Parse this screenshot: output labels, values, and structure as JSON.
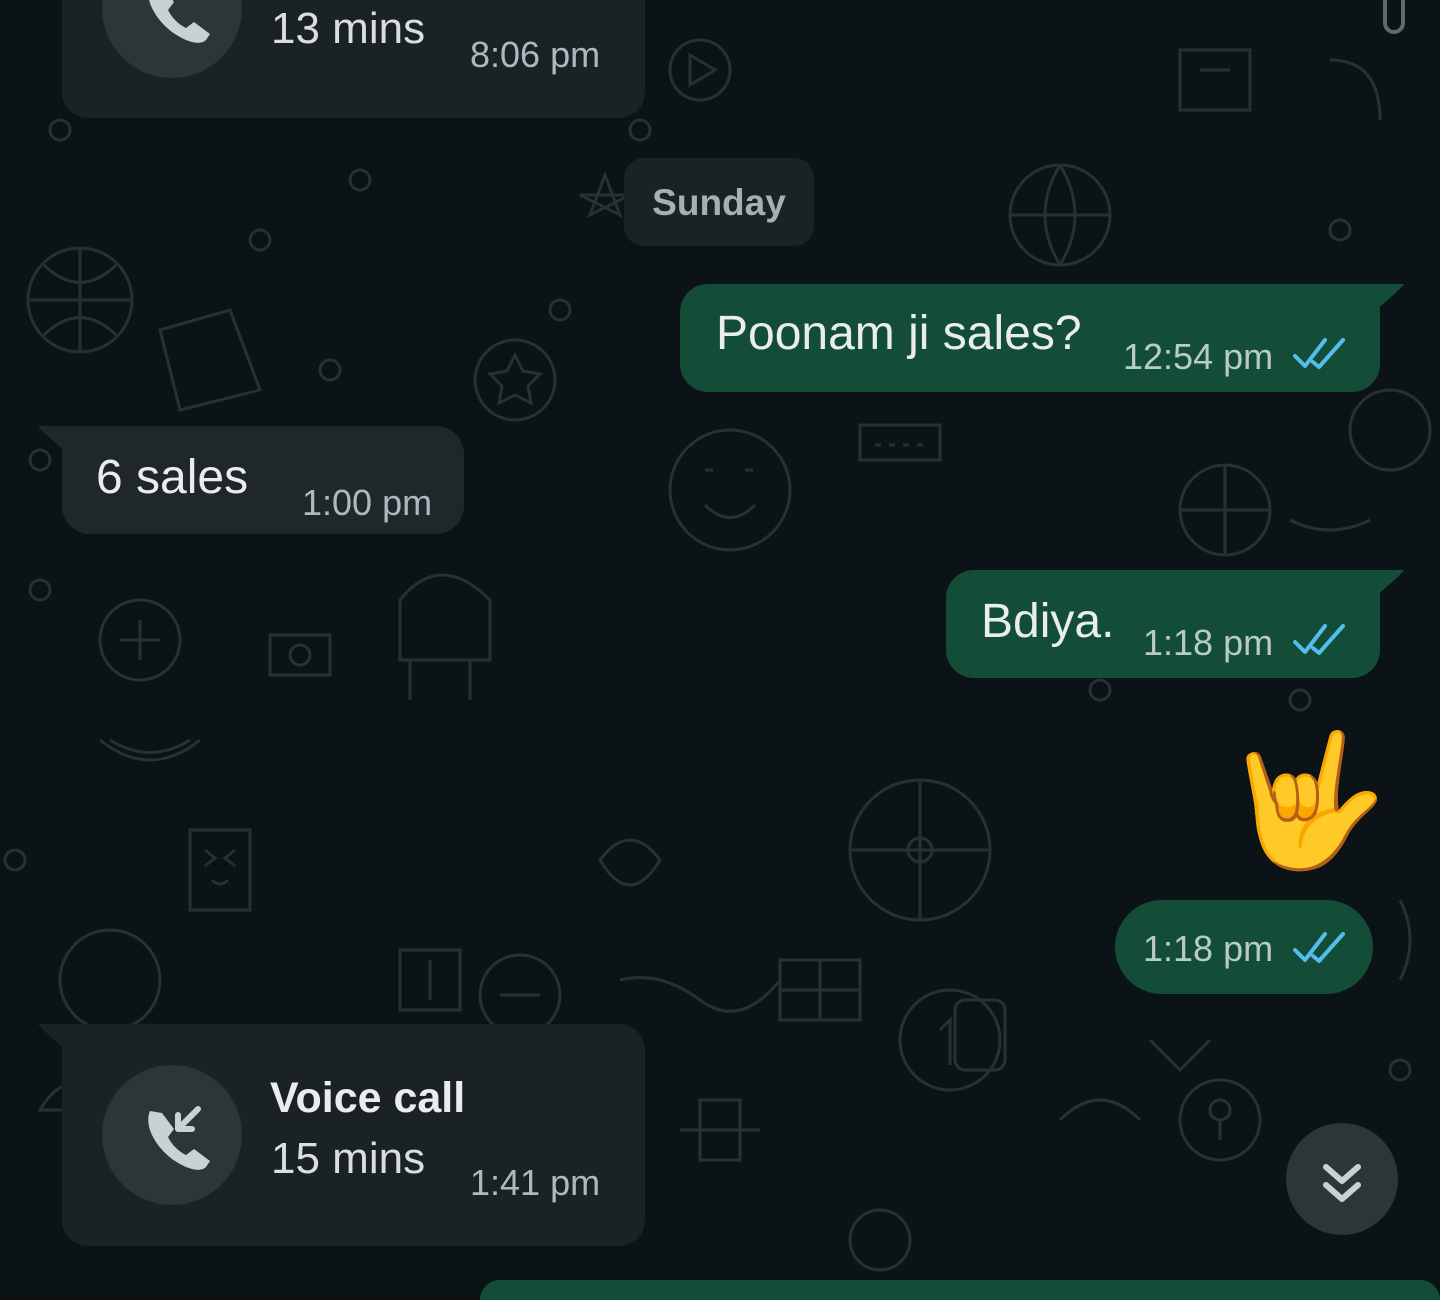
{
  "colors": {
    "background": "#0c1317",
    "incoming_bubble": "#1f272a",
    "outgoing_bubble": "#144d37",
    "read_ticks": "#53bdeb"
  },
  "top_call": {
    "duration": "13 mins",
    "time": "8:06 pm",
    "icon": "phone-call-icon"
  },
  "date_divider": "Sunday",
  "messages": [
    {
      "direction": "outgoing",
      "text": "Poonam ji sales?",
      "time": "12:54 pm",
      "status": "read"
    },
    {
      "direction": "incoming",
      "text": "6 sales",
      "time": "1:00 pm"
    },
    {
      "direction": "outgoing",
      "text": "Bdiya.",
      "time": "1:18 pm",
      "status": "read"
    },
    {
      "direction": "outgoing",
      "text": "🤟",
      "time": "1:18 pm",
      "status": "read"
    }
  ],
  "voice_call": {
    "title": "Voice call",
    "duration": "15 mins",
    "time": "1:41 pm",
    "icon": "incoming-call-icon"
  },
  "scroll_down_icon": "double-chevron-down-icon"
}
